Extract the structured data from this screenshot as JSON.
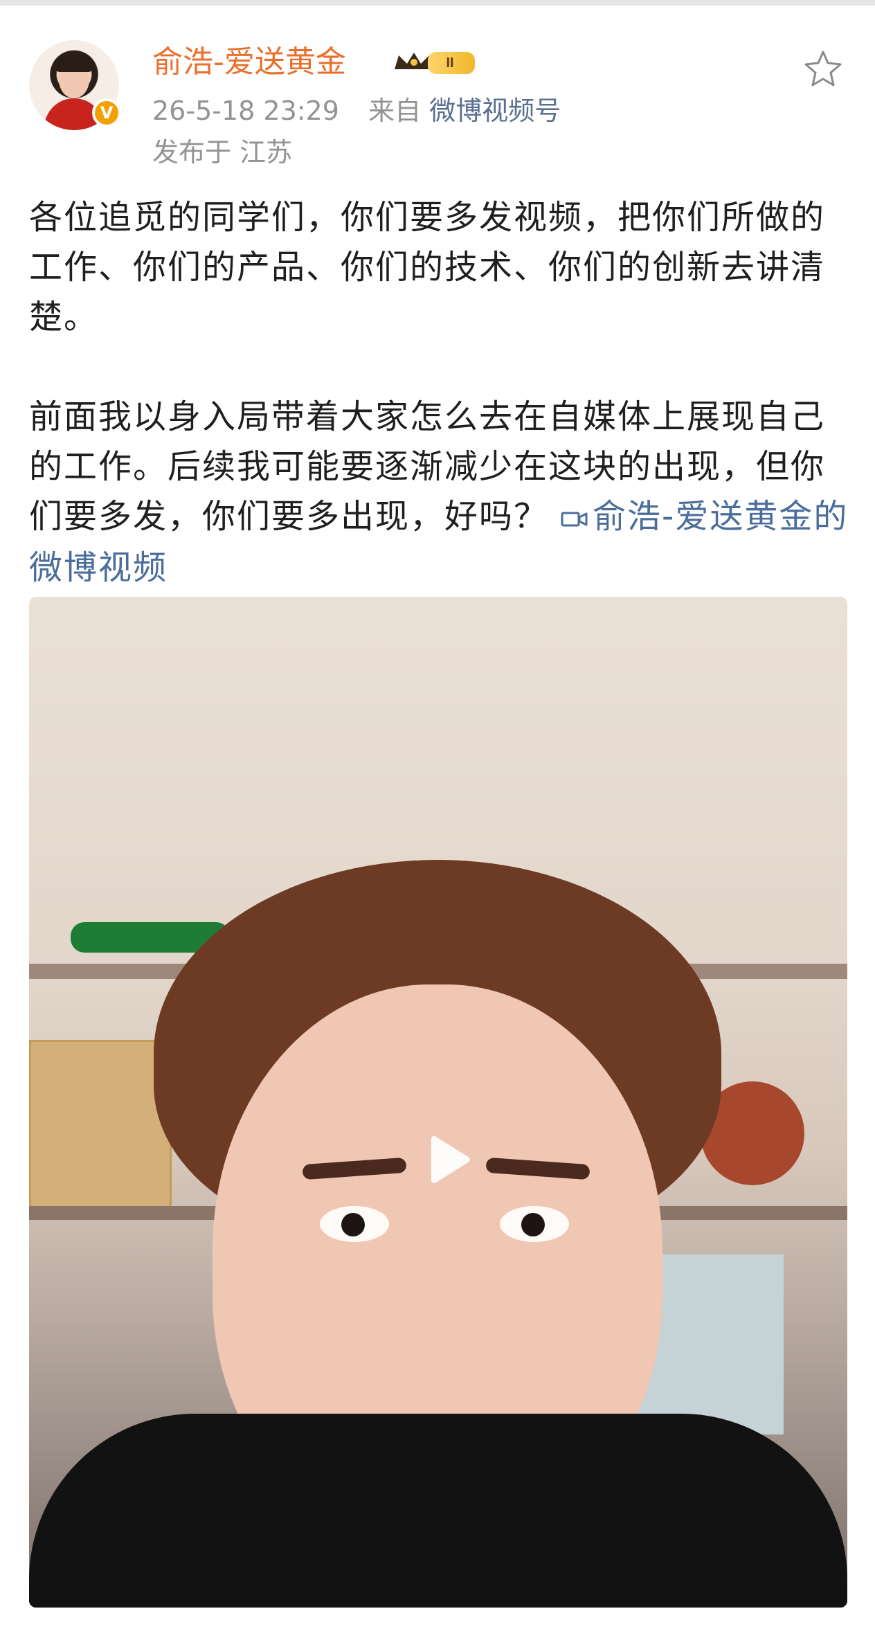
{
  "user": {
    "name": "俞浩-爱送黄金",
    "vip_level": "II",
    "verified_mark": "V"
  },
  "post": {
    "timestamp": "26-5-18 23:29",
    "source_prefix": "来自",
    "source": "微博视频号",
    "location_text": "发布于 江苏",
    "paragraph1": "各位追觅的同学们，你们要多发视频，把你们所做的工作、你们的产品、你们的技术、你们的创新去讲清楚。",
    "paragraph2": "前面我以身入局带着大家怎么去在自媒体上展现自己的工作。后续我可能要逐渐减少在这块的出现，但你们要多发，你们要多出现，好吗？",
    "video_link": "俞浩-爱送黄金的微博视频"
  },
  "icons": {
    "favorite": "star-icon",
    "play": "play-icon",
    "video": "video-link-icon",
    "crown": "crown-badge-icon"
  },
  "colors": {
    "username": "#ea6f2d",
    "link": "#4b6d9b",
    "meta": "#939393"
  }
}
